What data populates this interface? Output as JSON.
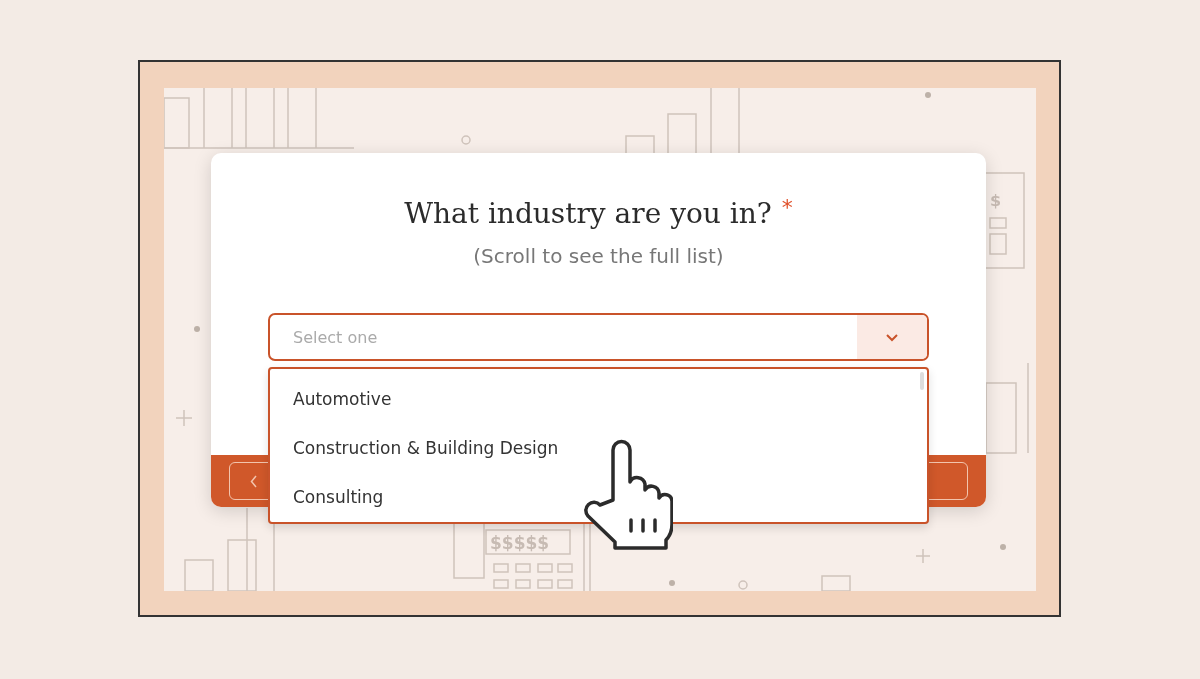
{
  "question": {
    "title": "What industry are you in?",
    "required_mark": "*",
    "hint": "(Scroll to see the full list)"
  },
  "select": {
    "placeholder": "Select one",
    "expanded": true
  },
  "options": [
    {
      "label": "Automotive",
      "selected": false
    },
    {
      "label": "Construction & Building Design",
      "selected": false
    },
    {
      "label": "Consulting",
      "selected": false
    }
  ],
  "footer": {
    "buttons": [
      {
        "kind": "back"
      },
      {
        "kind": "next"
      }
    ]
  },
  "background": {
    "calculator_text": "$$$$$",
    "register_text": "$"
  }
}
